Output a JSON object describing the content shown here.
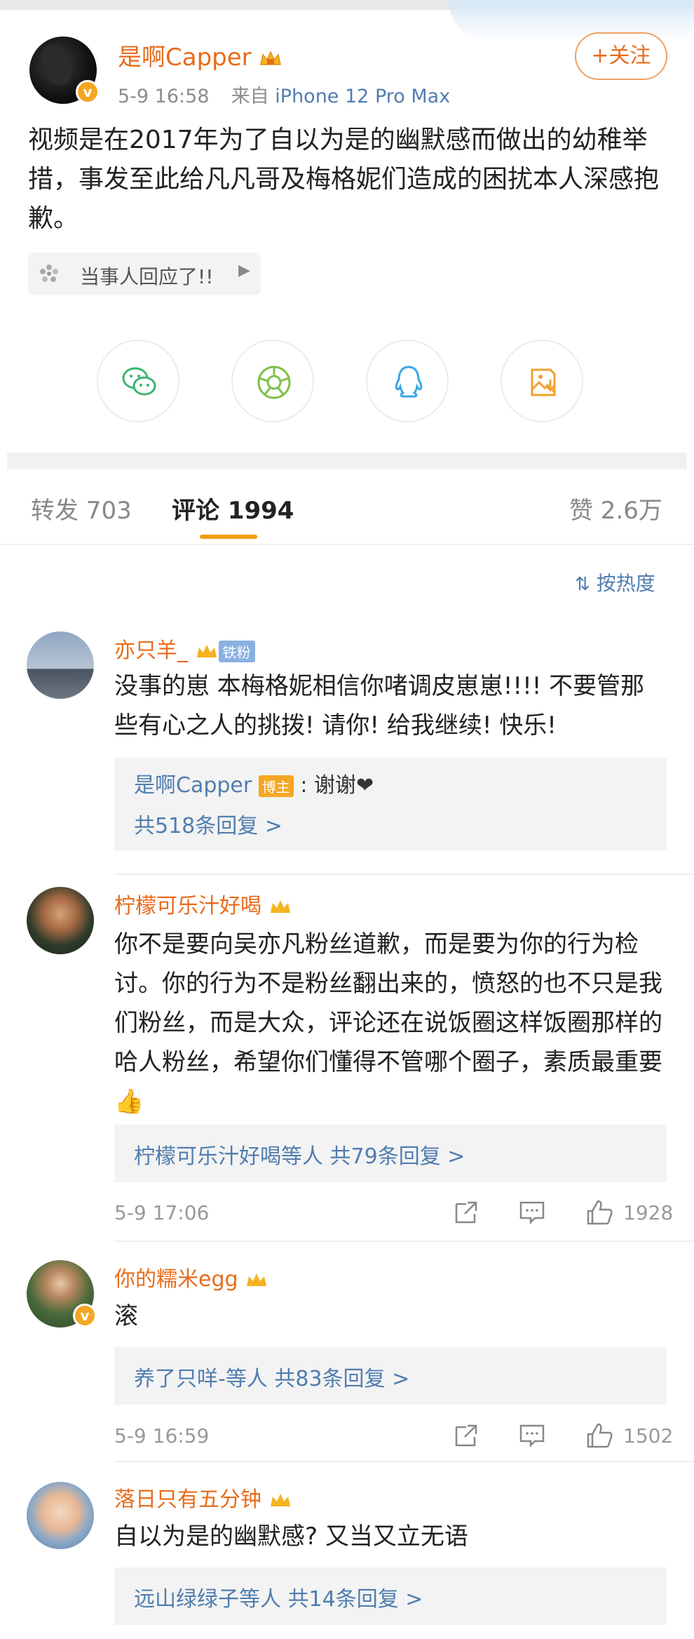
{
  "post": {
    "username": "是啊Capper",
    "time": "5-9 16:58",
    "source_prefix": "来自",
    "source": "iPhone 12 Pro Max",
    "follow_label": "+关注",
    "text": "视频是在2017年为了自以为是的幽默感而做出的幼稚举措，事发至此给凡凡哥及梅格妮们造成的困扰本人深感抱歉。",
    "topic_chip": "当事人回应了!!",
    "share_icons": [
      "wechat-icon",
      "moments-icon",
      "qq-icon",
      "save-image-icon"
    ]
  },
  "tabs": {
    "repost_label": "转发 703",
    "comment_label": "评论 1994",
    "like_label": "赞 2.6万"
  },
  "sort": {
    "label": "按热度"
  },
  "comments": [
    {
      "name": "亦只羊_",
      "badge": "铁粉",
      "text": "没事的崽 本梅格妮相信你啫调皮崽崽!!!! 不要管那些有心之人的挑拨! 请你! 给我继续! 快乐!",
      "reply_author": "是啊Capper",
      "reply_badge": "博主",
      "reply_text": ": 谢谢❤",
      "reply_count": "共518条回复 >"
    },
    {
      "name": "柠檬可乐汁好喝",
      "text": "你不是要向吴亦凡粉丝道歉，而是要为你的行为检讨。你的行为不是粉丝翻出来的，愤怒的也不只是我们粉丝，而是大众，评论还在说饭圈这样饭圈那样的哈人粉丝，希望你们懂得不管哪个圈子，素质最重要👍",
      "reply_summary": "柠檬可乐汁好喝等人",
      "reply_count": "共79条回复 >",
      "time": "5-9 17:06",
      "likes": "1928"
    },
    {
      "name": "你的糯米egg",
      "text": "滚",
      "reply_summary": "养了只咩-等人",
      "reply_count": "共83条回复 >",
      "time": "5-9 16:59",
      "likes": "1502"
    },
    {
      "name": "落日只有五分钟",
      "text": "自以为是的幽默感? 又当又立无语",
      "reply_summary": "远山绿绿子等人",
      "reply_count": "共14条回复 >"
    }
  ],
  "colors": {
    "accent_orange": "#e86b1a",
    "link_blue": "#507daf",
    "tab_underline": "#f39c12"
  }
}
